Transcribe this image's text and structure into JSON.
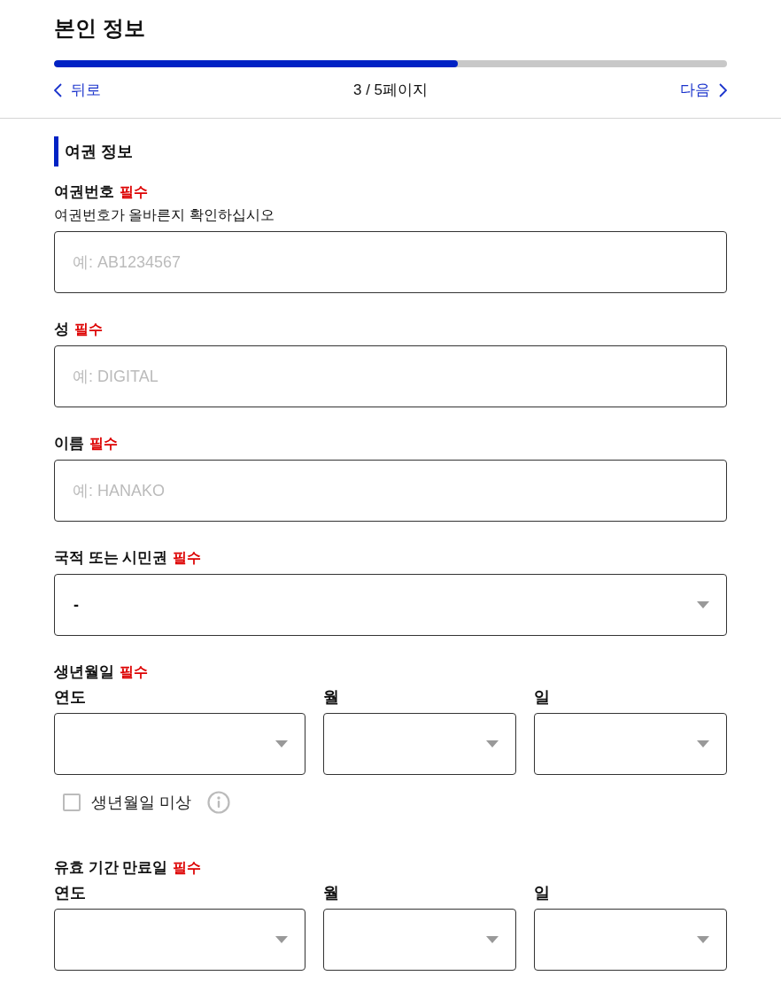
{
  "header": {
    "title": "본인 정보",
    "progress": {
      "level": 0.6
    },
    "back": {
      "label": "뒤로"
    },
    "page_indicator": "3 / 5페이지",
    "next": {
      "label": "다음"
    }
  },
  "section": {
    "title": "여권 정보"
  },
  "fields": [
    {
      "kind": "text",
      "label": "여권번호",
      "required_label": "필수",
      "hint": "여권번호가 올바른지 확인하십시오",
      "placeholder": "예: AB1234567"
    },
    {
      "kind": "text",
      "label": "성",
      "required_label": "필수",
      "placeholder": "예: DIGITAL"
    },
    {
      "kind": "text",
      "label": "이름",
      "required_label": "필수",
      "placeholder": "예: HANAKO"
    },
    {
      "kind": "select",
      "label": "국적 또는 시민권",
      "required_label": "필수",
      "value": "-"
    },
    {
      "kind": "date",
      "label": "생년월일",
      "required_label": "필수",
      "parts": [
        {
          "label": "연도"
        },
        {
          "label": "월"
        },
        {
          "label": "일"
        }
      ],
      "checkbox": {
        "label": "생년월일 미상",
        "checked": false
      }
    },
    {
      "kind": "date",
      "label": "유효 기간 만료일",
      "required_label": "필수",
      "parts": [
        {
          "label": "연도"
        },
        {
          "label": "월"
        },
        {
          "label": "일"
        }
      ]
    }
  ]
}
